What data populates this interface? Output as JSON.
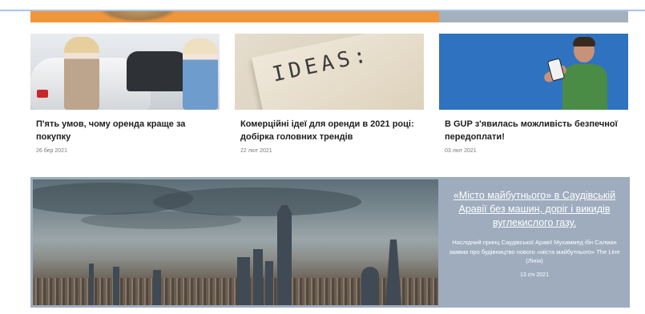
{
  "articles": [
    {
      "title": "П'ять умов, чому оренда краще за покупку",
      "date": "26 бер 2021"
    },
    {
      "title": "Комерційні ідеї для оренди в 2021 році: добірка головних трендів",
      "date": "22 лют 2021",
      "image_text": "IDEAS:"
    },
    {
      "title": "В GUP з'явилась можливість безпечної передоплати!",
      "date": "03 лют 2021"
    }
  ],
  "featured": {
    "headline": "«Місто майбутнього» в Саудівській Аравії без машин, доріг і викидів вуглекислого газу.",
    "description": "Наслідний принц Саудівської Аравії Мухаммед ібн Салман заявив про будівництво нового «міста майбутнього» The Line (Лінія)",
    "date": "13 січ 2021"
  },
  "colors": {
    "banner": "#f0953a",
    "feature_bg": "#9eacbe",
    "promo_blue": "#2f72bf"
  }
}
